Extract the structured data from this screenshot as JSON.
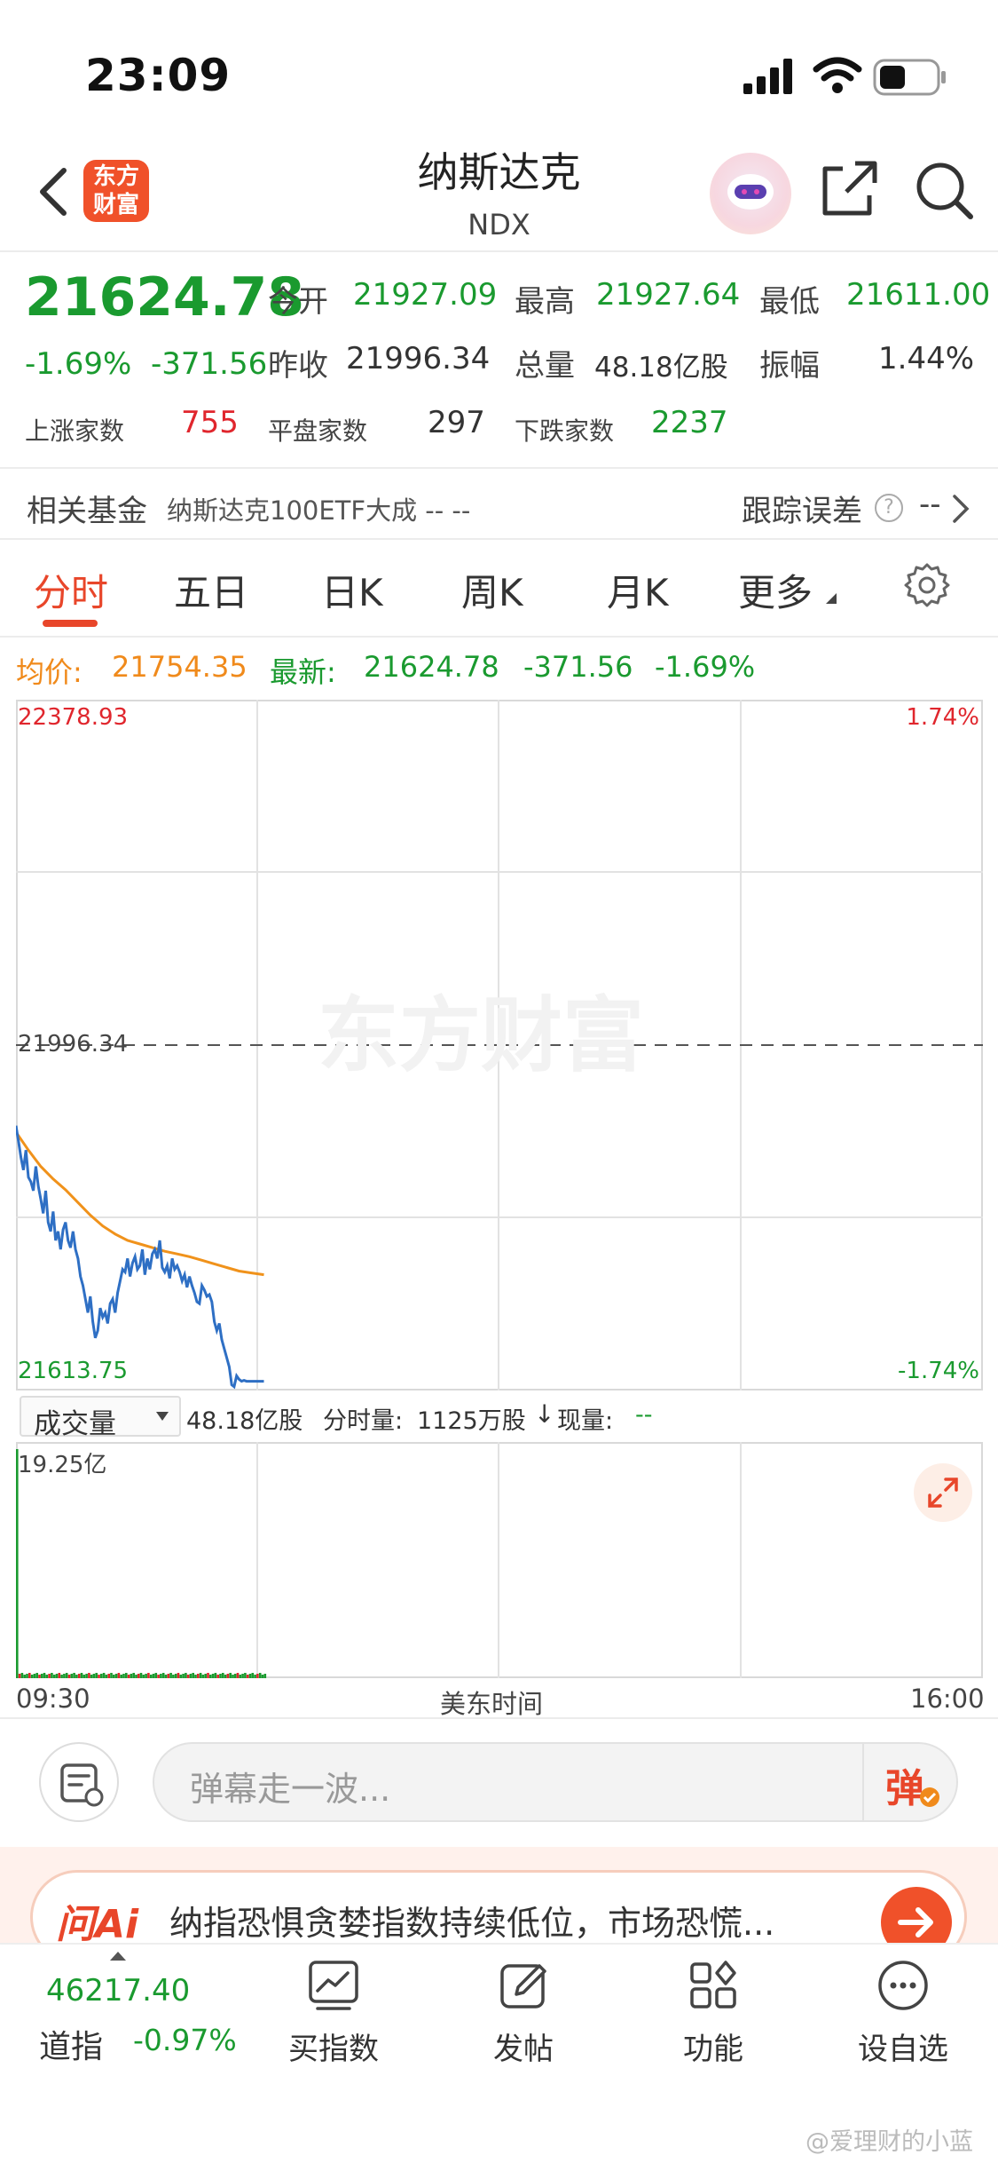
{
  "status": {
    "time": "23:09"
  },
  "nav": {
    "logo_line1": "东方",
    "logo_line2": "财富",
    "title": "纳斯达克",
    "subtitle": "NDX"
  },
  "quote": {
    "price": "21624.78",
    "pct": "-1.69%",
    "change": "-371.56",
    "open_label": "今开",
    "open": "21927.09",
    "high_label": "最高",
    "high": "21927.64",
    "low_label": "最低",
    "low": "21611.00",
    "prev_label": "昨收",
    "prev": "21996.34",
    "volume_label": "总量",
    "volume": "48.18亿股",
    "amp_label": "振幅",
    "amp": "1.44%",
    "up_label": "上涨家数",
    "up": "755",
    "flat_label": "平盘家数",
    "flat": "297",
    "down_label": "下跌家数",
    "down": "2237"
  },
  "fund": {
    "label": "相关基金",
    "name": "纳斯达克100ETF大成 -- --",
    "tracking_label": "跟踪误差",
    "tracking_value": "--"
  },
  "tabs": [
    "分时",
    "五日",
    "日K",
    "周K",
    "月K",
    "更多"
  ],
  "chart_legend": {
    "avg_label": "均价:",
    "avg": "21754.35",
    "latest_label": "最新:",
    "latest": "21624.78",
    "change": "-371.56",
    "pct": "-1.69%"
  },
  "chart_data": {
    "type": "line",
    "title": "",
    "ylim": [
      21613.75,
      22378.93
    ],
    "y_top_label": "22378.93",
    "y_mid_label": "21996.34",
    "y_bottom_label": "21613.75",
    "pct_top": "1.74%",
    "pct_bottom": "-1.74%",
    "x_start": "09:30",
    "x_mid": "美东时间",
    "x_end": "16:00",
    "session_minutes": 390,
    "series": [
      {
        "color": "#2e6fc4",
        "x": [
          0,
          1,
          2,
          3,
          4,
          5,
          6,
          7,
          8,
          9,
          10,
          11,
          12,
          13,
          14,
          15,
          16,
          17,
          18,
          19,
          20,
          21,
          22,
          23,
          24,
          25,
          26,
          27,
          28,
          29,
          30,
          31,
          32,
          33,
          34,
          35,
          36,
          37,
          38,
          39,
          40,
          41,
          42,
          43,
          44,
          45,
          46,
          47,
          48,
          49,
          50,
          51,
          52,
          53,
          54,
          55,
          56,
          57,
          58,
          59,
          60,
          61,
          62,
          63,
          64,
          65,
          66,
          67,
          68,
          69,
          70,
          71,
          72,
          73,
          74,
          75,
          76,
          77,
          78,
          79,
          80,
          81,
          82,
          83,
          84,
          85,
          86,
          87,
          88,
          89,
          90,
          91,
          92,
          93,
          94,
          95,
          96,
          97,
          98,
          99,
          100
        ],
        "values": [
          21907,
          21890,
          21872,
          21858,
          21880,
          21850,
          21845,
          21835,
          21862,
          21840,
          21826,
          21810,
          21835,
          21800,
          21790,
          21812,
          21780,
          21790,
          21770,
          21792,
          21800,
          21780,
          21772,
          21790,
          21770,
          21760,
          21740,
          21730,
          21715,
          21700,
          21718,
          21690,
          21672,
          21680,
          21705,
          21695,
          21700,
          21688,
          21710,
          21715,
          21700,
          21722,
          21735,
          21748,
          21745,
          21760,
          21740,
          21755,
          21762,
          21748,
          21752,
          21770,
          21742,
          21760,
          21748,
          21765,
          21770,
          21760,
          21780,
          21750,
          21745,
          21752,
          21738,
          21760,
          21748,
          21752,
          21745,
          21735,
          21742,
          21728,
          21740,
          21730,
          21722,
          21712,
          21710,
          21730,
          21725,
          21718,
          21720,
          21712,
          21690,
          21680,
          21688,
          21670,
          21660,
          21650,
          21640,
          21620,
          21618,
          21630,
          21626,
          21624,
          21625,
          21624,
          21624,
          21624,
          21624,
          21624,
          21624,
          21624,
          21624
        ]
      },
      {
        "color": "#f0921b",
        "x": [
          0,
          5,
          10,
          15,
          20,
          25,
          30,
          35,
          40,
          45,
          50,
          55,
          60,
          65,
          70,
          75,
          80,
          85,
          90,
          95,
          100
        ],
        "values": [
          21900,
          21880,
          21862,
          21848,
          21836,
          21822,
          21808,
          21796,
          21787,
          21780,
          21776,
          21772,
          21768,
          21765,
          21762,
          21758,
          21754,
          21750,
          21746,
          21744,
          21742
        ]
      }
    ],
    "volume": {
      "label": "成交量",
      "total": "48.18亿股",
      "minute_label": "分时量:",
      "minute_value": "1125万股",
      "now_label": "现量:",
      "now_value": "--",
      "ymax_label": "19.25亿",
      "ymax": 19.25
    }
  },
  "watermark": "东方财富",
  "danmu": {
    "placeholder": "弹幕走一波...",
    "button": "弹"
  },
  "ai_banner": {
    "logo": "问Ai",
    "text": "纳指恐惧贪婪指数持续低位，市场恐慌..."
  },
  "tabbar": {
    "index_value": "46217.40",
    "index_name": "道指",
    "index_pct": "-0.97%",
    "items": [
      "买指数",
      "发帖",
      "功能",
      "设自选"
    ]
  },
  "weibo_mark": "@爱理财的小蓝",
  "colors": {
    "up": "#e0262d",
    "down": "#1a9a2f",
    "accent": "#e8462a",
    "price_line": "#2e6fc4",
    "avg_line": "#f0921b"
  }
}
